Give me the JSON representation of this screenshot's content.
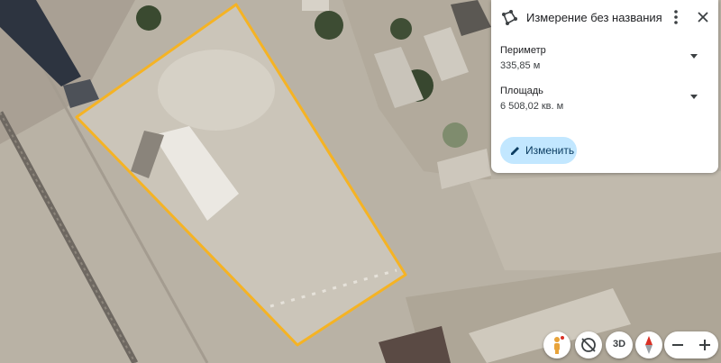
{
  "measurement": {
    "title": "Измерение без названия",
    "perimeter_label": "Периметр",
    "perimeter_value": "335,85 м",
    "area_label": "Площадь",
    "area_value": "6 508,02 кв. м",
    "edit_label": "Изменить"
  },
  "controls": {
    "threed_label": "3D"
  },
  "icons": {
    "measure": "measure-polygon-icon",
    "more": "more-vert-icon",
    "close": "close-icon",
    "dropdown": "chevron-down-icon",
    "edit": "pencil-icon",
    "pegman": "pegman-icon",
    "tilt": "rotate-view-icon",
    "compass": "compass-icon",
    "zoom_out": "minus-icon",
    "zoom_in": "plus-icon"
  },
  "colors": {
    "polygon_outline": "#f5b324",
    "edit_button_bg": "#c2e7ff",
    "compass_north": "#d93025"
  }
}
